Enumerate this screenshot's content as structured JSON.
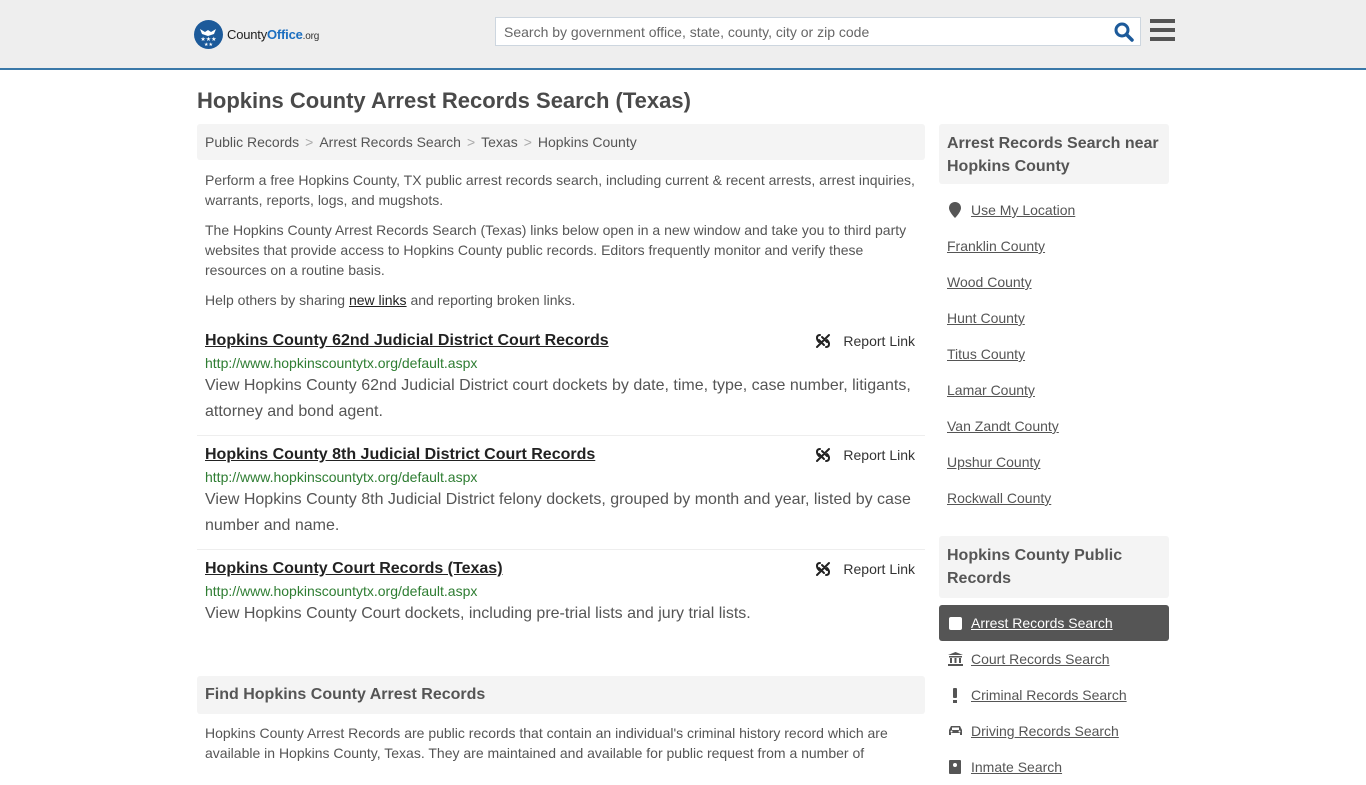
{
  "header": {
    "logo": {
      "prefix": "County",
      "office": "Office",
      "suffix": ".org"
    },
    "search": {
      "placeholder": "Search by government office, state, county, city or zip code",
      "value": ""
    },
    "icons": {
      "search": "search-icon",
      "menu": "hamburger-menu-icon"
    }
  },
  "page": {
    "title": "Hopkins County Arrest Records Search (Texas)",
    "breadcrumb": [
      "Public Records",
      "Arrest Records Search",
      "Texas",
      "Hopkins County"
    ],
    "intro": {
      "p1": "Perform a free Hopkins County, TX public arrest records search, including current & recent arrests, arrest inquiries, warrants, reports, logs, and mugshots.",
      "p2": "The Hopkins County Arrest Records Search (Texas) links below open in a new window and take you to third party websites that provide access to Hopkins County public records. Editors frequently monitor and verify these resources on a routine basis.",
      "p3_before": "Help others by sharing ",
      "p3_link": "new links",
      "p3_after": " and reporting broken links."
    },
    "report_label": "Report Link",
    "results": [
      {
        "title": "Hopkins County 62nd Judicial District Court Records",
        "url": "http://www.hopkinscountytx.org/default.aspx",
        "description": "View Hopkins County 62nd Judicial District court dockets by date, time, type, case number, litigants, attorney and bond agent."
      },
      {
        "title": "Hopkins County 8th Judicial District Court Records",
        "url": "http://www.hopkinscountytx.org/default.aspx",
        "description": "View Hopkins County 8th Judicial District felony dockets, grouped by month and year, listed by case number and name."
      },
      {
        "title": "Hopkins County Court Records (Texas)",
        "url": "http://www.hopkinscountytx.org/default.aspx",
        "description": "View Hopkins County Court dockets, including pre-trial lists and jury trial lists."
      }
    ],
    "find": {
      "heading": "Find Hopkins County Arrest Records",
      "text": "Hopkins County Arrest Records are public records that contain an individual's criminal history record which are available in Hopkins County, Texas. They are maintained and available for public request from a number of"
    }
  },
  "sidebar": {
    "nearby": {
      "heading": "Arrest Records Search near Hopkins County",
      "use_location": "Use My Location",
      "counties": [
        "Franklin County",
        "Wood County",
        "Hunt County",
        "Titus County",
        "Lamar County",
        "Van Zandt County",
        "Upshur County",
        "Rockwall County"
      ]
    },
    "public_records": {
      "heading": "Hopkins County Public Records",
      "items": [
        {
          "label": "Arrest Records Search",
          "icon": "square-icon",
          "active": true
        },
        {
          "label": "Court Records Search",
          "icon": "courthouse-icon",
          "active": false
        },
        {
          "label": "Criminal Records Search",
          "icon": "exclamation-icon",
          "active": false
        },
        {
          "label": "Driving Records Search",
          "icon": "car-icon",
          "active": false
        },
        {
          "label": "Inmate Search",
          "icon": "inmate-icon",
          "active": false
        }
      ]
    }
  }
}
